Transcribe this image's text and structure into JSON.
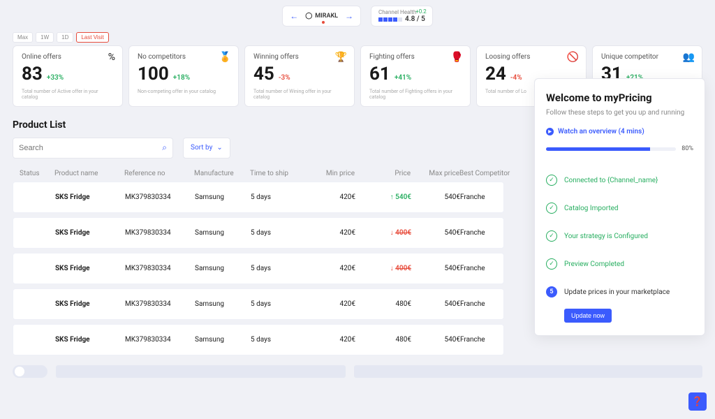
{
  "channel_name": "MIRAKL",
  "channel_health": {
    "label": "Channel Health",
    "score": "4.8 / 5",
    "delta": "+0.2"
  },
  "time_filters": [
    "Max",
    "1W",
    "1D",
    "Last Visit"
  ],
  "time_active_index": 3,
  "stats": [
    {
      "title": "Online offers",
      "value": "83",
      "delta": "+33%",
      "dir": "up",
      "desc": "Total number of Active offer in your catalog",
      "icon": "percent-badge-icon",
      "glyph": "%"
    },
    {
      "title": "No competitors",
      "value": "100",
      "delta": "+18%",
      "dir": "up",
      "desc": "Non-competing offer in your catalog",
      "icon": "award-icon",
      "glyph": "🏅"
    },
    {
      "title": "Winning offers",
      "value": "45",
      "delta": "-3%",
      "dir": "down",
      "desc": "Total number of Wining offer in your catalog",
      "icon": "trophy-icon",
      "glyph": "🏆"
    },
    {
      "title": "Fighting offers",
      "value": "61",
      "delta": "+41%",
      "dir": "up",
      "desc": "Total number of Fighting offers in your catalog",
      "icon": "boxing-icon",
      "glyph": "🥊"
    },
    {
      "title": "Loosing offers",
      "value": "24",
      "delta": "-4%",
      "dir": "down",
      "desc": "Total number of Lo",
      "icon": "no-entry-icon",
      "glyph": "🚫"
    },
    {
      "title": "Unique competitor",
      "value": "31",
      "delta": "+21%",
      "dir": "up",
      "desc": "",
      "icon": "group-icon",
      "glyph": "👥"
    }
  ],
  "product_list_title": "Product List",
  "search_placeholder": "Search",
  "sort_label": "Sort by",
  "columns": [
    "Status",
    "Product name",
    "Reference no",
    "Manufacture",
    "Time to ship",
    "Min price",
    "Price",
    "Max price",
    "Best Competitor"
  ],
  "rows": [
    {
      "status": "green",
      "name": "SKS Fridge",
      "ref": "MK379830334",
      "mfr": "Samsung",
      "ship": "5 days",
      "min": "420€",
      "price": "540€",
      "pdir": "up",
      "max": "540€",
      "comp": "Franche"
    },
    {
      "status": "red",
      "name": "SKS Fridge",
      "ref": "MK379830334",
      "mfr": "Samsung",
      "ship": "5 days",
      "min": "420€",
      "price": "400€",
      "pdir": "down",
      "max": "540€",
      "comp": "Franche"
    },
    {
      "status": "red",
      "name": "SKS Fridge",
      "ref": "MK379830334",
      "mfr": "Samsung",
      "ship": "5 days",
      "min": "420€",
      "price": "400€",
      "pdir": "down",
      "max": "540€",
      "comp": "Franche"
    },
    {
      "status": "green",
      "name": "SKS Fridge",
      "ref": "MK379830334",
      "mfr": "Samsung",
      "ship": "5 days",
      "min": "420€",
      "price": "480€",
      "pdir": "",
      "max": "540€",
      "comp": "Franche"
    },
    {
      "status": "green",
      "name": "SKS Fridge",
      "ref": "MK379830334",
      "mfr": "Samsung",
      "ship": "5 days",
      "min": "420€",
      "price": "480€",
      "pdir": "",
      "max": "540€",
      "comp": "Franche"
    }
  ],
  "onboard": {
    "title": "Welcome to myPricing",
    "subtitle": "Follow these steps to get you up and running",
    "watch_label": "Watch an overview (4 mins)",
    "progress": "80%",
    "steps_done": [
      "Connected to {Channel_name}",
      "Catalog Imported",
      "Your strategy is Configured",
      "Preview Completed"
    ],
    "pending_step_num": "5",
    "pending_step_label": "Update prices in your marketplace",
    "pending_button": "Update now"
  },
  "help_glyph": "❓"
}
